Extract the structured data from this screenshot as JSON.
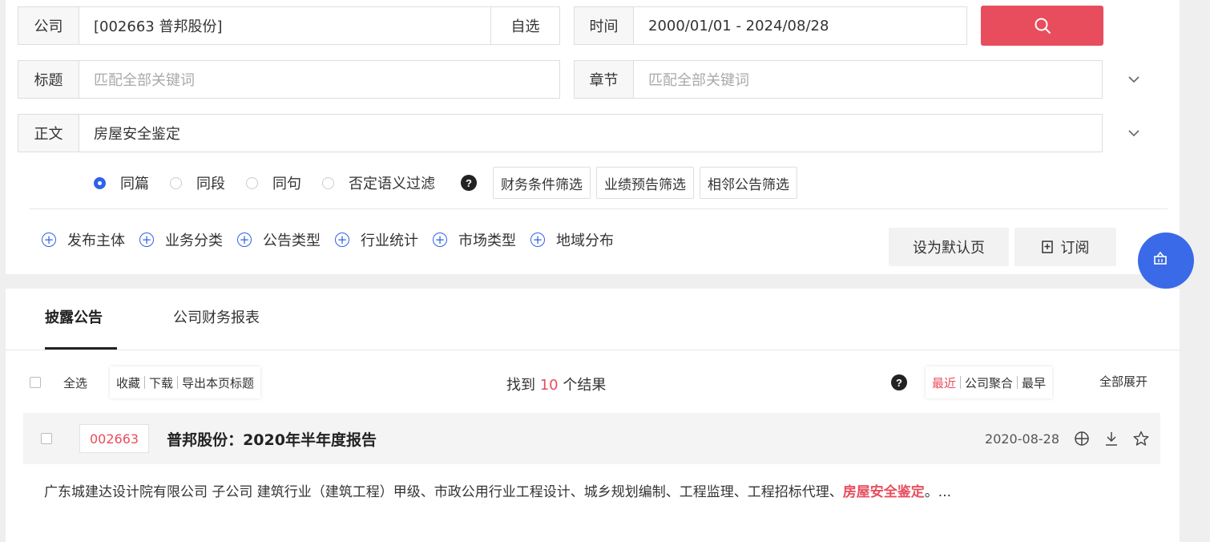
{
  "search": {
    "company": {
      "label": "公司",
      "value": "[002663 普邦股份]",
      "pick_label": "自选"
    },
    "time": {
      "label": "时间",
      "value": "2000/01/01 - 2024/08/28"
    },
    "title": {
      "label": "标题",
      "placeholder": "匹配全部关键词"
    },
    "chapter": {
      "label": "章节",
      "placeholder": "匹配全部关键词"
    },
    "body": {
      "label": "正文",
      "value": "房屋安全鉴定"
    },
    "button_color": "#e84d5d"
  },
  "scope": {
    "options": [
      "同篇",
      "同段",
      "同句",
      "否定语义过滤"
    ],
    "selected": "同篇"
  },
  "filters": [
    "财务条件筛选",
    "业绩预告筛选",
    "相邻公告筛选"
  ],
  "categories": [
    "发布主体",
    "业务分类",
    "公告类型",
    "行业统计",
    "市场类型",
    "地域分布"
  ],
  "actions": {
    "set_default": "设为默认页",
    "subscribe": "订阅"
  },
  "tabs": [
    "披露公告",
    "公司财务报表"
  ],
  "toolbar": {
    "select_all": "全选",
    "collect": "收藏",
    "download": "下载",
    "export": "导出本页标题",
    "found_prefix": "找到",
    "found_count": "10",
    "found_suffix": "个结果",
    "sort": {
      "recent": "最近",
      "group": "公司聚合",
      "earliest": "最早"
    },
    "expand_all": "全部展开"
  },
  "result": {
    "code": "002663",
    "title": "普邦股份：2020年半年度报告",
    "date": "2020-08-28",
    "snippet_prefix": "广东城建达设计院有限公司 子公司 建筑行业（建筑工程）甲级、市政公用行业工程设计、城乡规划编制、工程监理、工程招标代理、",
    "snippet_highlight": "房屋安全鉴定",
    "snippet_suffix": "。..."
  },
  "colors": {
    "accent": "#2e62e8",
    "highlight": "#e84d5d"
  }
}
